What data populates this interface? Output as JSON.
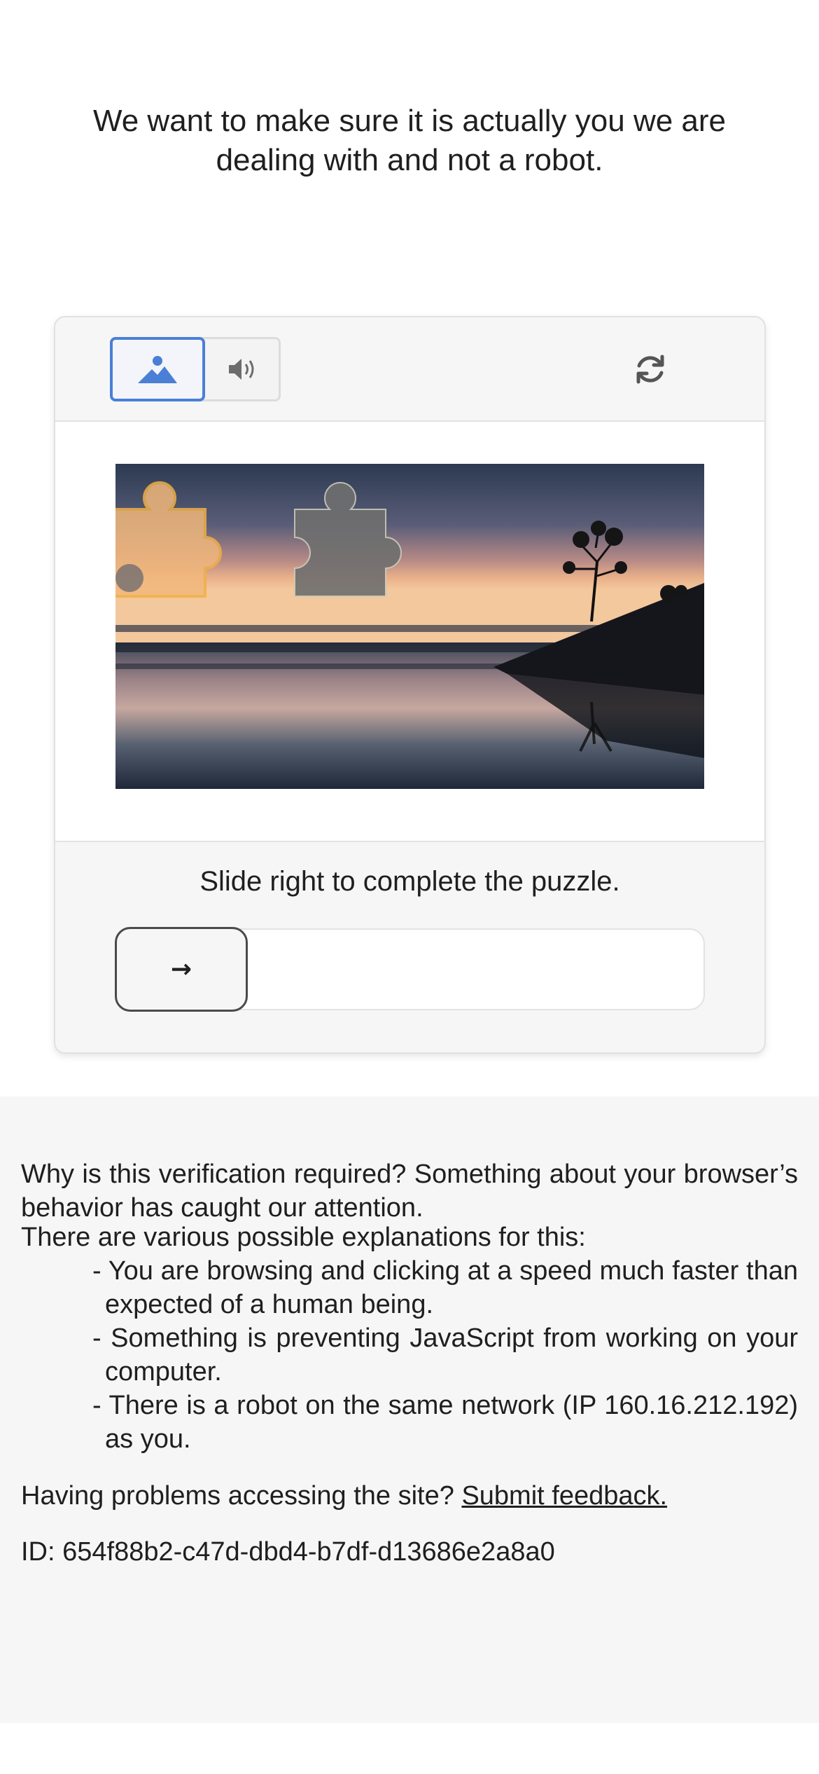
{
  "headline": "We want to make sure it is actually you we are dealing with and not a robot.",
  "captcha": {
    "modes": {
      "image": "image-mode",
      "audio": "audio-mode"
    },
    "instruction": "Slide right to complete the puzzle.",
    "slider_arrow": "→",
    "accent_color": "#4a7fd6"
  },
  "info": {
    "why_text": "Why is this verification required? Something about your browser’s behavior has caught our attention.",
    "explanations_intro": "There are various possible explanations for this:",
    "explanations": [
      "- You are browsing and clicking at a speed much faster than expected of a human being.",
      "- Something is preventing JavaScript from working on your computer.",
      "- There is a robot on the same network (IP 160.16.212.192) as you."
    ],
    "problems_text": "Having problems accessing the site?",
    "feedback_link": "Submit feedback.",
    "id_text": "ID: 654f88b2-c47d-dbd4-b7df-d13686e2a8a0"
  }
}
